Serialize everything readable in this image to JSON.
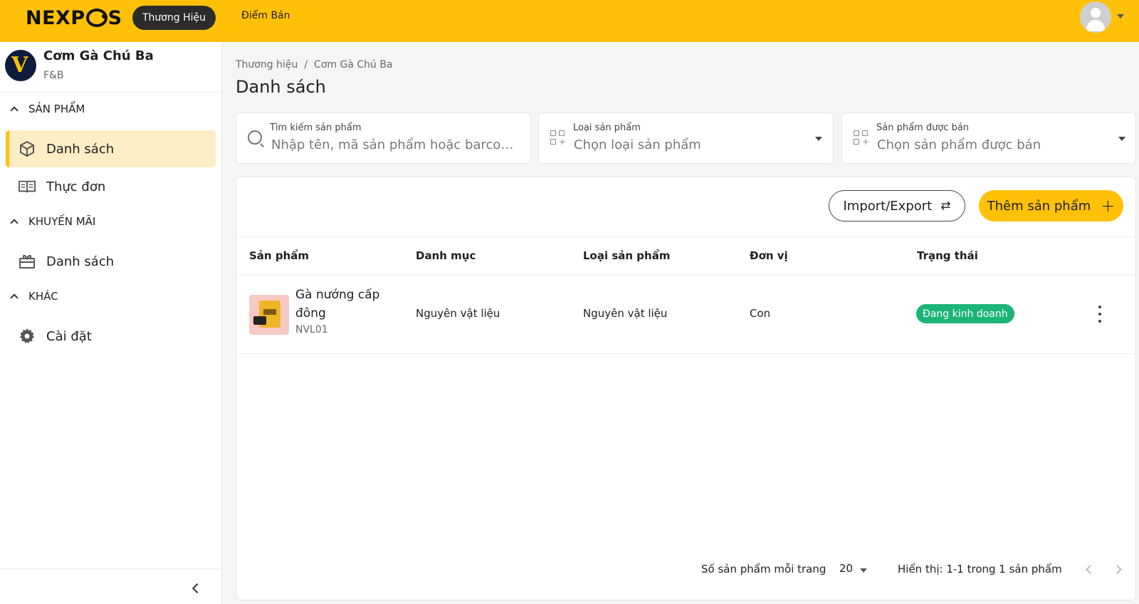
{
  "topbar": {
    "logo": "NEXPOS",
    "logo_parts": [
      "NEXP",
      "S"
    ],
    "nav": [
      {
        "label": "Thương Hiệu",
        "active": true
      },
      {
        "label": "Điểm Bán",
        "active": false
      }
    ],
    "brand_color": "#ffc107"
  },
  "sidebar": {
    "org": {
      "name": "Cơm Gà Chú Ba",
      "type": "F&B",
      "avatar_letter": "V"
    },
    "sections": [
      {
        "title": "SẢN PHẨM",
        "items": [
          {
            "label": "Danh sách",
            "icon": "box-icon",
            "active": true
          },
          {
            "label": "Thực đơn",
            "icon": "book-icon",
            "active": false
          }
        ]
      },
      {
        "title": "KHUYẾN MÃI",
        "items": [
          {
            "label": "Danh sách",
            "icon": "gift-icon",
            "active": false
          }
        ]
      },
      {
        "title": "KHÁC",
        "items": [
          {
            "label": "Cài đặt",
            "icon": "gear-icon",
            "active": false
          }
        ]
      }
    ]
  },
  "main": {
    "breadcrumb": [
      "Thương hiệu",
      "Cơm Gà Chú Ba"
    ],
    "breadcrumb_sep": "/",
    "title": "Danh sách",
    "filters": {
      "search": {
        "label": "Tìm kiếm sản phẩm",
        "placeholder": "Nhập tên, mã sản phẩm hoặc barcode..."
      },
      "type": {
        "label": "Loại sản phẩm",
        "placeholder": "Chọn loại sản phẩm"
      },
      "sold": {
        "label": "Sản phẩm được bán",
        "placeholder": "Chọn sản phẩm được bán"
      }
    },
    "actions": {
      "import_export": "Import/Export",
      "add_product": "Thêm sản phẩm"
    },
    "table": {
      "columns": [
        "Sản phẩm",
        "Danh mục",
        "Loại sản phẩm",
        "Đơn vị",
        "Trạng thái"
      ],
      "rows": [
        {
          "name": "Gà nướng cấp đông",
          "code": "NVL01",
          "category": "Nguyên vật liệu",
          "type": "Nguyên vật liệu",
          "unit": "Con",
          "status": "Đang kinh doanh",
          "status_color": "#1bb477"
        }
      ]
    },
    "pagination": {
      "per_page_label": "Số sản phẩm mỗi trang",
      "per_page": "20",
      "summary": "Hiển thị: 1-1 trong 1 sản phẩm"
    }
  }
}
